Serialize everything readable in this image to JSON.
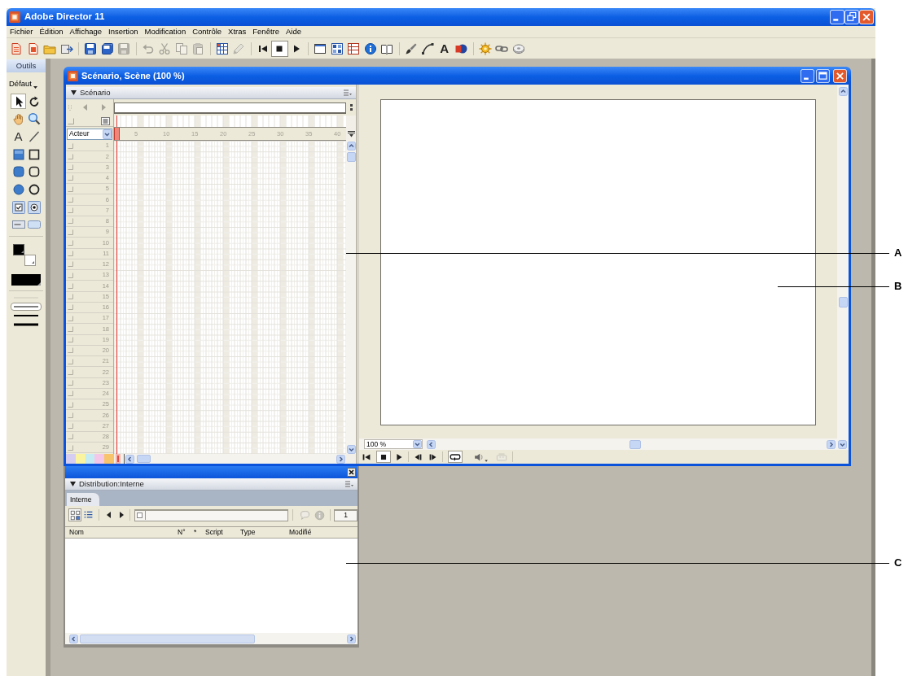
{
  "app": {
    "title": "Adobe Director 11"
  },
  "menu": [
    "Fichier",
    "Édition",
    "Affichage",
    "Insertion",
    "Modification",
    "Contrôle",
    "Xtras",
    "Fenêtre",
    "Aide"
  ],
  "toolbar": [
    [
      {
        "disabled": false,
        "pressed": false
      },
      {
        "disabled": false,
        "pressed": false
      },
      {
        "disabled": false,
        "pressed": false
      },
      {
        "disabled": false,
        "pressed": false
      }
    ],
    [
      {
        "disabled": false,
        "pressed": false
      },
      {
        "disabled": false,
        "pressed": false
      },
      {
        "disabled": true,
        "pressed": false
      }
    ],
    [
      {
        "disabled": true,
        "pressed": false
      },
      {
        "disabled": true,
        "pressed": false
      },
      {
        "disabled": true,
        "pressed": false
      },
      {
        "disabled": true,
        "pressed": false
      }
    ],
    [
      {
        "disabled": false,
        "pressed": false
      },
      {
        "disabled": true,
        "pressed": false
      }
    ],
    [
      {
        "disabled": false,
        "pressed": false
      },
      {
        "disabled": false,
        "pressed": true
      },
      {
        "disabled": false,
        "pressed": false
      }
    ],
    [
      {
        "disabled": false,
        "pressed": false
      },
      {
        "disabled": false,
        "pressed": false
      },
      {
        "disabled": false,
        "pressed": false
      },
      {
        "disabled": false,
        "pressed": false
      },
      {
        "disabled": false,
        "pressed": false
      }
    ],
    [
      {
        "disabled": false,
        "pressed": false
      },
      {
        "disabled": false,
        "pressed": false
      },
      {
        "glyph": "A",
        "disabled": false,
        "pressed": false
      },
      {
        "disabled": false,
        "pressed": false
      }
    ],
    [
      {
        "disabled": false,
        "pressed": false
      },
      {
        "disabled": false,
        "pressed": false
      },
      {
        "disabled": false,
        "pressed": false
      }
    ]
  ],
  "tools_panel": {
    "title": "Outils",
    "preset": "Défaut",
    "tools": [
      {
        "selected": true
      },
      {
        "selected": false
      },
      {
        "selected": false
      },
      {
        "selected": false
      },
      {
        "glyph": "A",
        "selected": false
      },
      {
        "selected": false
      },
      {
        "selected": false
      },
      {
        "selected": false
      },
      {
        "selected": false
      },
      {
        "selected": false
      },
      {
        "selected": false
      },
      {
        "selected": false
      },
      {
        "selected": false
      },
      {
        "selected": false
      },
      {
        "selected": false
      },
      {
        "selected": false
      }
    ],
    "line_widths": [
      {
        "selected": false
      },
      {
        "selected": true
      },
      {
        "selected": false
      },
      {
        "selected": false
      }
    ]
  },
  "stage_window": {
    "title": "Scénario, Scène (100 %)",
    "score": {
      "title": "Scénario",
      "member_dropdown": "Acteur",
      "frame_ruler": [
        "5",
        "10",
        "15",
        "20",
        "25",
        "30",
        "35",
        "40"
      ],
      "channels": [
        "1",
        "2",
        "3",
        "4",
        "5",
        "6",
        "7",
        "8",
        "9",
        "10",
        "11",
        "12",
        "13",
        "14",
        "15",
        "16",
        "17",
        "18",
        "19",
        "20",
        "21",
        "22",
        "23",
        "24",
        "25",
        "26",
        "27",
        "28",
        "29"
      ],
      "label_colors": [
        {
          "color": "#d6cdf2"
        },
        {
          "color": "#faf3a0"
        },
        {
          "color": "#c4ecf2"
        },
        {
          "color": "#f4c6e8"
        },
        {
          "color": "#f7c46b"
        }
      ]
    },
    "stage": {
      "zoom": "100 %",
      "controls": [
        {
          "pressed": false,
          "disabled": false
        },
        {
          "pressed": true,
          "disabled": false
        },
        {
          "pressed": false,
          "disabled": false
        },
        {
          "pressed": false,
          "disabled": false
        },
        {
          "pressed": false,
          "disabled": false
        },
        {
          "pressed": true,
          "disabled": false
        },
        {
          "pressed": false,
          "disabled": false
        },
        {
          "pressed": false,
          "disabled": true
        }
      ]
    }
  },
  "cast_window": {
    "title": "Distribution:Interne",
    "tabs": [
      {
        "label": "Interne",
        "selected": true
      }
    ],
    "view_buttons": [
      {
        "selected": true
      },
      {
        "selected": false
      }
    ],
    "actions": [
      {
        "disabled": true
      },
      {
        "disabled": true
      }
    ],
    "page": "1",
    "columns": [
      "Nom",
      "N°",
      "*",
      "Script",
      "Type",
      "Modifié"
    ]
  },
  "callouts": [
    "A",
    "B",
    "C"
  ]
}
